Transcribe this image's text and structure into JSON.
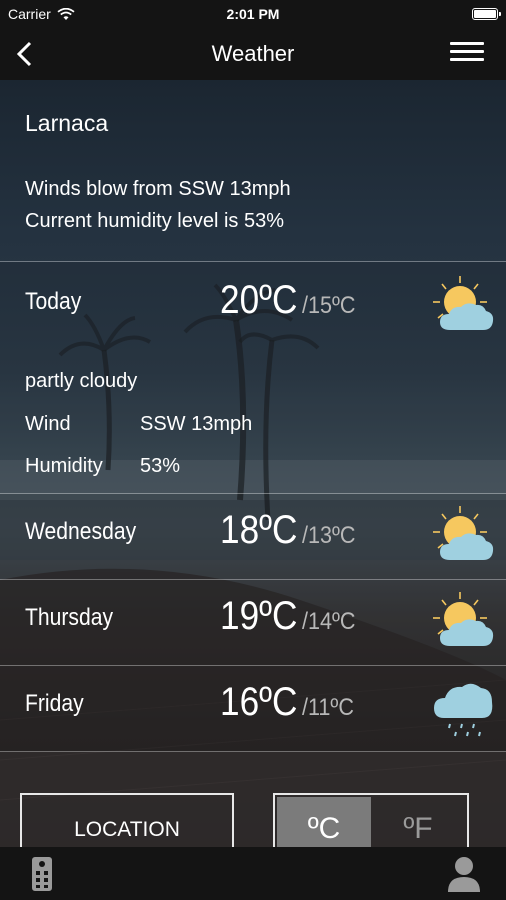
{
  "status": {
    "carrier": "Carrier",
    "time": "2:01 PM"
  },
  "nav": {
    "title": "Weather",
    "back_icon": "chevron-left-icon",
    "menu_icon": "hamburger-menu-icon"
  },
  "current": {
    "city": "Larnaca",
    "wind_text": "Winds blow from SSW 13mph",
    "humidity_text": "Current humidity level is 53%"
  },
  "today": {
    "name": "Today",
    "high": "20ºC",
    "low": "/15ºC",
    "icon": "partly-cloudy-icon",
    "description": "partly cloudy",
    "wind_label": "Wind",
    "wind_value": "SSW 13mph",
    "humidity_label": "Humidity",
    "humidity_value": "53%"
  },
  "forecast": [
    {
      "name": "Wednesday",
      "high": "18ºC",
      "low": "/13ºC",
      "icon": "partly-cloudy-icon"
    },
    {
      "name": "Thursday",
      "high": "19ºC",
      "low": "/14ºC",
      "icon": "partly-cloudy-icon"
    },
    {
      "name": "Friday",
      "high": "16ºC",
      "low": "/11ºC",
      "icon": "rain-cloud-icon"
    }
  ],
  "controls": {
    "location_label": "LOCATION",
    "celsius_label": "ºC",
    "fahrenheit_label": "ºF",
    "selected_unit": "celsius"
  },
  "tabbar": {
    "left_icon": "remote-control-icon",
    "right_icon": "user-profile-icon"
  },
  "colors": {
    "bar_bg": "#141414",
    "sun": "#f6c85f",
    "cloud": "#9fd0e0",
    "active_toggle": "#7b7b7b"
  }
}
